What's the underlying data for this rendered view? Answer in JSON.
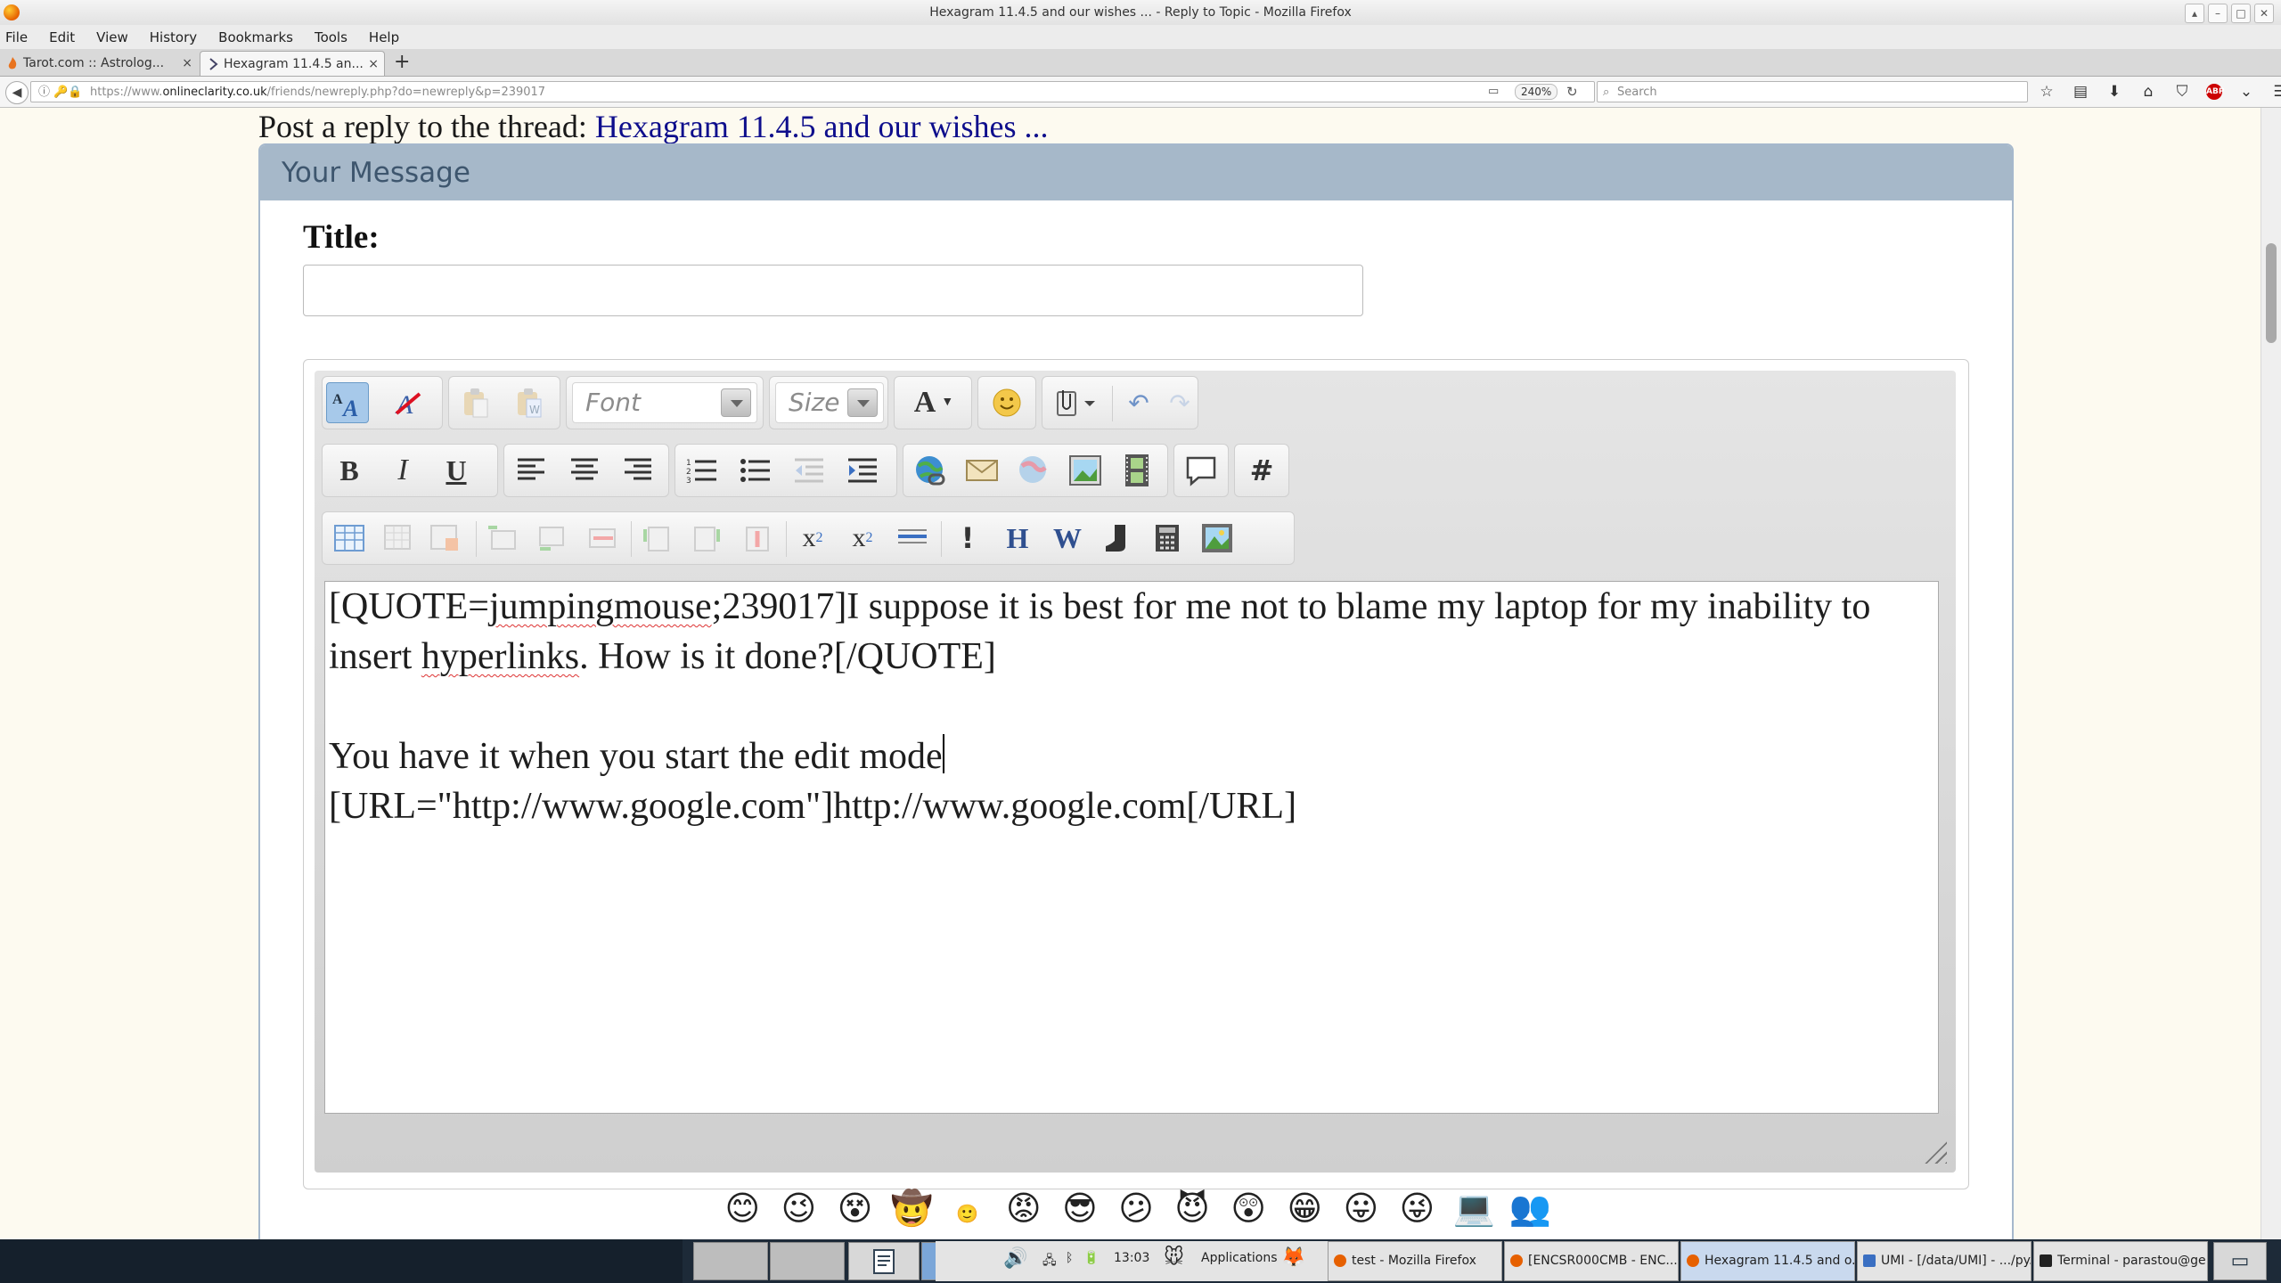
{
  "window": {
    "title": "Hexagram 11.4.5 and our wishes ... - Reply to Topic - Mozilla Firefox"
  },
  "menu": [
    "File",
    "Edit",
    "View",
    "History",
    "Bookmarks",
    "Tools",
    "Help"
  ],
  "tabs": [
    {
      "label": "Tarot.com :: Astrolog...",
      "close": "×"
    },
    {
      "label": "Hexagram 11.4.5 an...",
      "close": "×"
    }
  ],
  "newtab": "+",
  "nav": {
    "url_prefix": "https://www.",
    "url_domain": "onlineclarity.co.uk",
    "url_path": "/friends/newreply.php?do=newreply&p=239017",
    "zoom": "240%",
    "search_placeholder": "Search"
  },
  "page": {
    "heading_prefix": "Post a reply to the thread:",
    "heading_link": "Hexagram 11.4.5 and our wishes ...",
    "panel_title": "Your Message",
    "title_label": "Title:",
    "title_value": ""
  },
  "editor": {
    "font_placeholder": "Font",
    "size_placeholder": "Size",
    "text": {
      "quote_open": "[QUOTE=",
      "quote_user": "jumpingmouse",
      "quote_id": ";239017]I suppose it is best for me not to blame my laptop for my inability to insert ",
      "quote_word": "hyperlinks",
      "quote_rest": ". How is it done?[/QUOTE]",
      "line2": "You have it when you start the edit mode",
      "line3": "[URL=\"http://www.google.com\"]http://www.google.com[/URL]"
    }
  },
  "taskbar": {
    "clock": "13:03",
    "applications": "Applications",
    "items": [
      {
        "label": "test - Mozilla Firefox"
      },
      {
        "label": "[ENCSR000CMB - ENC..."
      },
      {
        "label": "Hexagram 11.4.5 and o..."
      },
      {
        "label": "UMI - [/data/UMI] - .../py..."
      },
      {
        "label": "Terminal - parastou@ge..."
      }
    ]
  }
}
